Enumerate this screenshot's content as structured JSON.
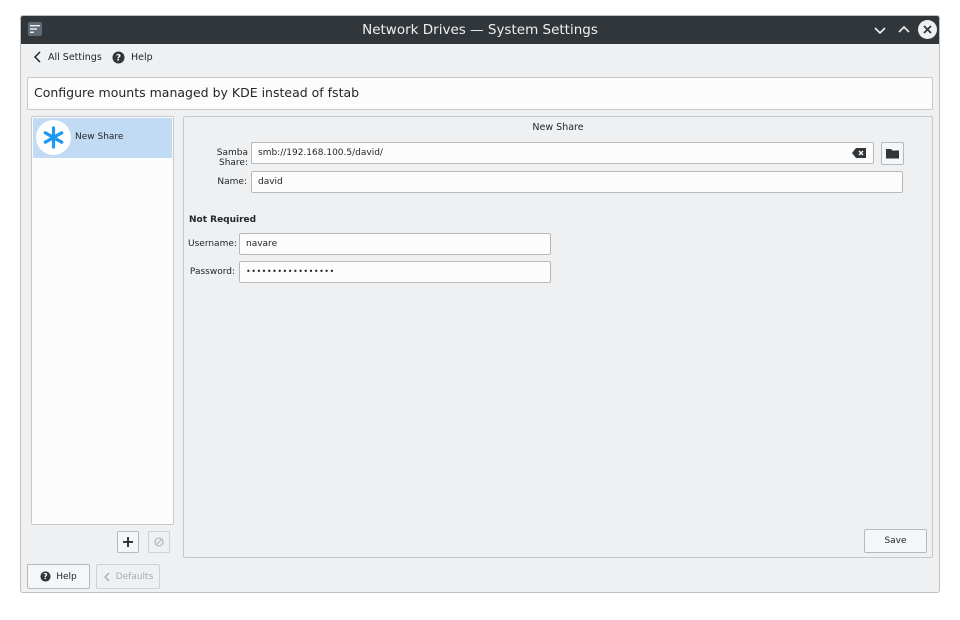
{
  "window": {
    "title": "Network Drives — System Settings"
  },
  "toolbar": {
    "back_label": "All Settings",
    "help_label": "Help"
  },
  "header": {
    "text": "Configure mounts managed by KDE instead of fstab"
  },
  "share_list": {
    "items": [
      {
        "label": "New Share",
        "icon": "asterisk-icon",
        "selected": true
      }
    ]
  },
  "form": {
    "title": "New Share",
    "samba_share_label": "Samba Share:",
    "samba_share_value": "smb://192.168.100.5/david/",
    "name_label": "Name:",
    "name_value": "david",
    "section_label": "Not Required",
    "username_label": "Username:",
    "username_value": "navare",
    "password_label": "Password:",
    "password_mask": "•••••••••••••••••",
    "save_label": "Save"
  },
  "footer": {
    "help_label": "Help",
    "defaults_label": "Defaults"
  },
  "colors": {
    "titlebar": "#31363b",
    "selection": "#c0dbf3",
    "accent": "#3daee9"
  }
}
